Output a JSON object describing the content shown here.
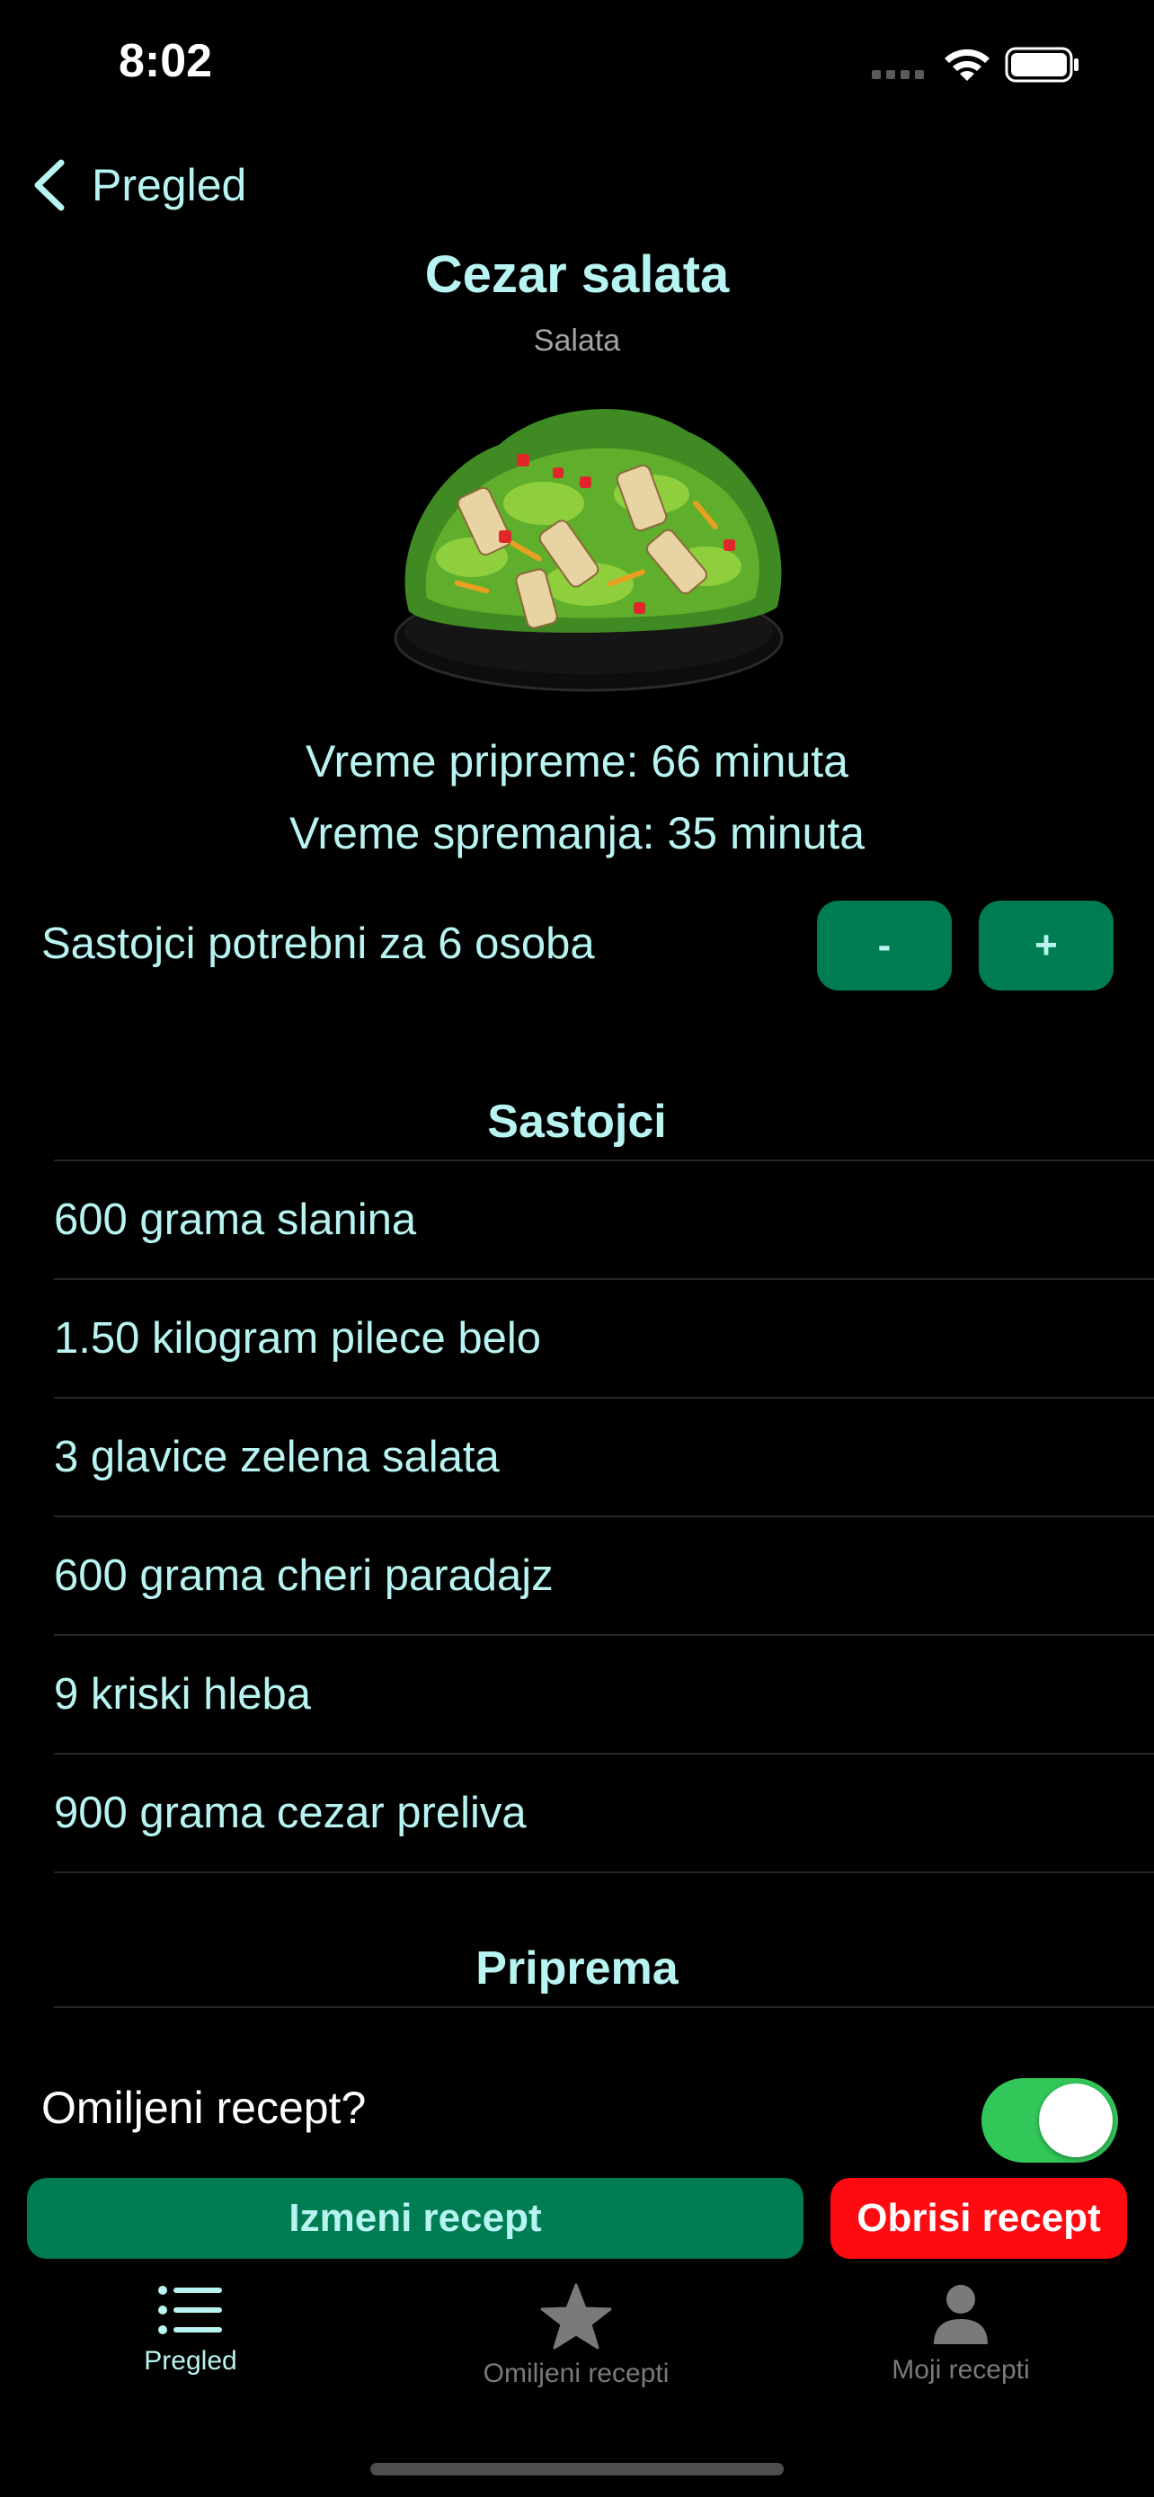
{
  "status_bar": {
    "time": "8:02"
  },
  "nav": {
    "back_label": "Pregled"
  },
  "recipe": {
    "title": "Cezar salata",
    "category": "Salata",
    "prep_time": "Vreme pripreme: 66 minuta",
    "cook_time": "Vreme spremanja: 35 minuta"
  },
  "servings": {
    "label": "Sastojci potrebni za 6 osoba",
    "minus_label": "-",
    "plus_label": "+"
  },
  "ingredients": {
    "heading": "Sastojci",
    "items": [
      "600 grama slanina",
      "1.50 kilogram pilece belo",
      "3 glavice zelena salata",
      "600 grama cheri paradajz",
      "9 kriski hleba",
      "900 grama cezar preliva"
    ]
  },
  "steps": {
    "heading": "Priprema"
  },
  "favorite": {
    "label": "Omiljeni recept?",
    "on": true
  },
  "actions": {
    "edit_label": "Izmeni recept",
    "delete_label": "Obrisi recept"
  },
  "tabs": [
    {
      "label": "Pregled",
      "icon": "list-icon",
      "active": true
    },
    {
      "label": "Omiljeni recepti",
      "icon": "star-icon",
      "active": false
    },
    {
      "label": "Moji recepti",
      "icon": "person-icon",
      "active": false
    }
  ],
  "colors": {
    "background": "#000000",
    "accent_text": "#b8f4f1",
    "primary_button": "#007c52",
    "danger_button": "#ff0a10",
    "toggle_on": "#32c759",
    "inactive_tab": "#7a7a7a"
  }
}
